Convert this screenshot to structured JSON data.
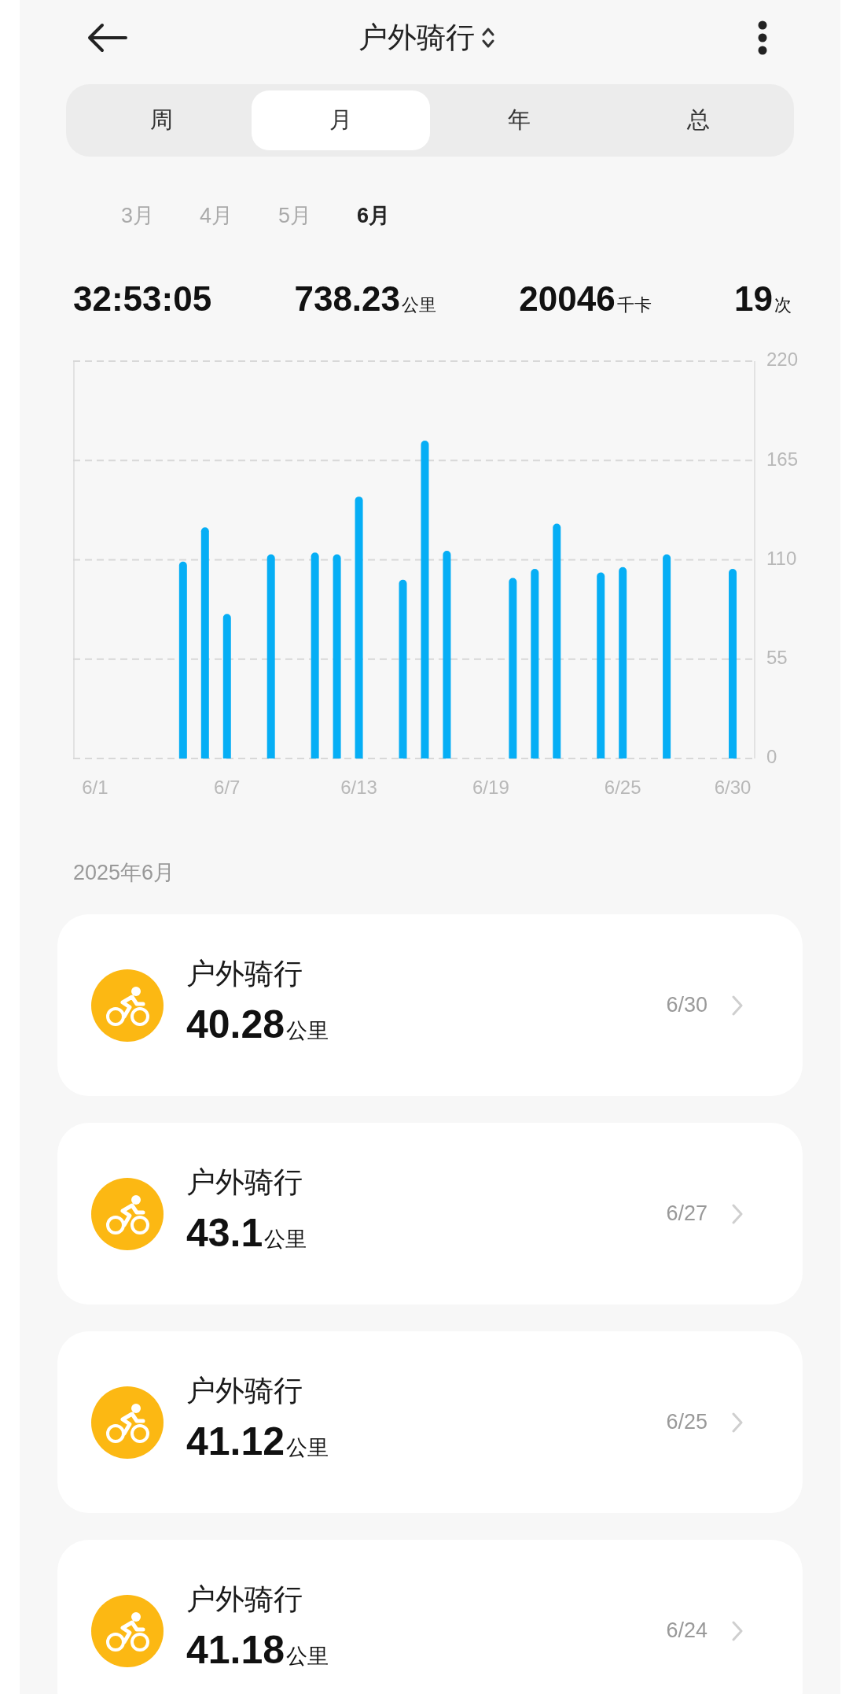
{
  "header": {
    "title": "户外骑行"
  },
  "period_tabs": [
    {
      "label": "周",
      "selected": false
    },
    {
      "label": "月",
      "selected": true
    },
    {
      "label": "年",
      "selected": false
    },
    {
      "label": "总",
      "selected": false
    }
  ],
  "months": [
    {
      "label": "3月",
      "selected": false
    },
    {
      "label": "4月",
      "selected": false
    },
    {
      "label": "5月",
      "selected": false
    },
    {
      "label": "6月",
      "selected": true
    }
  ],
  "summary": [
    {
      "value": "32:53:05"
    },
    {
      "value": "738.23",
      "unit": "公里"
    },
    {
      "value": "20046",
      "unit": "千卡"
    },
    {
      "value": "19",
      "unit": "次"
    }
  ],
  "chart": {
    "chart_data": {
      "type": "bar",
      "categories": [
        "6/1",
        null,
        null,
        null,
        null,
        null,
        "6/7",
        null,
        null,
        null,
        null,
        null,
        "6/13",
        null,
        null,
        null,
        null,
        null,
        "6/19",
        null,
        null,
        null,
        null,
        null,
        "6/25",
        null,
        null,
        null,
        null,
        "6/30"
      ],
      "values": [
        null,
        null,
        null,
        null,
        109,
        128,
        80,
        null,
        113,
        null,
        114,
        113,
        145,
        null,
        99,
        176,
        115,
        null,
        null,
        100,
        105,
        130,
        null,
        103,
        106,
        null,
        113,
        null,
        null,
        105
      ],
      "ylim": [
        0,
        220
      ],
      "yticks": [
        0,
        55,
        110,
        165,
        220
      ],
      "grid": true
    }
  },
  "section_title": "2025年6月",
  "activities": [
    {
      "name": "户外骑行",
      "distance": "40.28",
      "unit": "公里",
      "date": "6/30"
    },
    {
      "name": "户外骑行",
      "distance": "43.1",
      "unit": "公里",
      "date": "6/27"
    },
    {
      "name": "户外骑行",
      "distance": "41.12",
      "unit": "公里",
      "date": "6/25"
    },
    {
      "name": "户外骑行",
      "distance": "41.18",
      "unit": "公里",
      "date": "6/24"
    }
  ]
}
